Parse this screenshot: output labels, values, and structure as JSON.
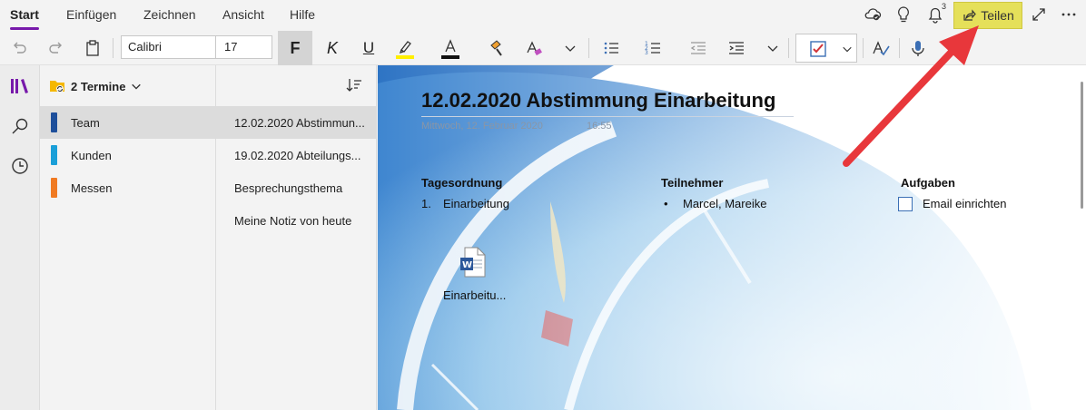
{
  "menu": {
    "tabs": [
      {
        "label": "Start",
        "active": true
      },
      {
        "label": "Einfügen"
      },
      {
        "label": "Zeichnen"
      },
      {
        "label": "Ansicht"
      },
      {
        "label": "Hilfe"
      }
    ],
    "notification_count": "3",
    "share_label": "Teilen"
  },
  "toolbar": {
    "font_name": "Calibri",
    "font_size": "17",
    "bold_label": "F",
    "italic_label": "K",
    "underline_label": "U"
  },
  "notebook": {
    "title": "2 Termine"
  },
  "sections": [
    {
      "label": "Team",
      "color": "#1e4f9b",
      "selected": true
    },
    {
      "label": "Kunden",
      "color": "#1a9fd8"
    },
    {
      "label": "Messen",
      "color": "#f07a22"
    }
  ],
  "pages": [
    {
      "label": "12.02.2020 Abstimmun...",
      "selected": true
    },
    {
      "label": "19.02.2020 Abteilungs..."
    },
    {
      "label": "Besprechungsthema"
    },
    {
      "label": "Meine Notiz von heute"
    }
  ],
  "note": {
    "title": "12.02.2020 Abstimmung Einarbeitung",
    "date": "Mittwoch, 12. Februar 2020",
    "time": "16:55",
    "agenda_heading": "Tagesordnung",
    "agenda_item_number": "1.",
    "agenda_item": "Einarbeitung",
    "participants_heading": "Teilnehmer",
    "participants_item": "Marcel, Mareike",
    "tasks_heading": "Aufgaben",
    "tasks_item": "Email einrichten",
    "attachment_label": "Einarbeitu..."
  },
  "colors": {
    "accent": "#7719aa",
    "share_highlight": "#e5e05a",
    "arrow": "#e8373b"
  }
}
